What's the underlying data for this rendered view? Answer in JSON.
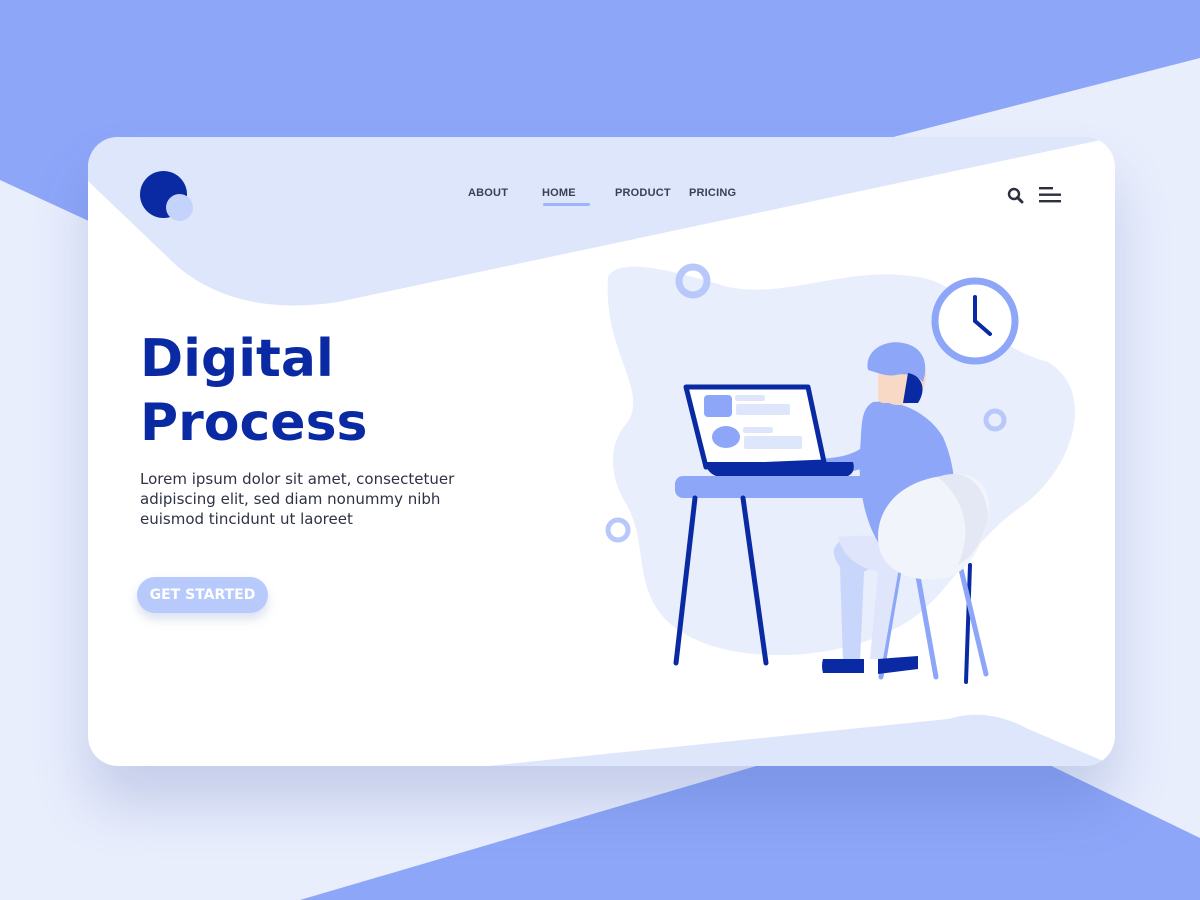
{
  "colors": {
    "brand": "#0a2aa3",
    "accent_light": "#b7cafb",
    "background_blue": "#8da6f8",
    "background_pale": "#e9eefd"
  },
  "logo": {
    "icon": "circles-logo-icon"
  },
  "nav": {
    "items": [
      {
        "label": "ABOUT"
      },
      {
        "label": "HOME",
        "active": true
      },
      {
        "label": "PRODUCT"
      },
      {
        "label": "PRICING"
      }
    ]
  },
  "header_icons": {
    "search": "search-icon",
    "menu": "hamburger-menu-icon"
  },
  "hero": {
    "title_line1": "Digital",
    "title_line2": "Process",
    "description": "Lorem ipsum dolor sit amet, consectetuer adipiscing elit, sed diam nonummy nibh euismod tincidunt ut laoreet",
    "cta_label": "GET STARTED"
  },
  "illustration": {
    "subject": "person-working-at-laptop",
    "icons": [
      "clock-icon",
      "laptop-icon",
      "chair-icon",
      "desk-icon"
    ]
  }
}
